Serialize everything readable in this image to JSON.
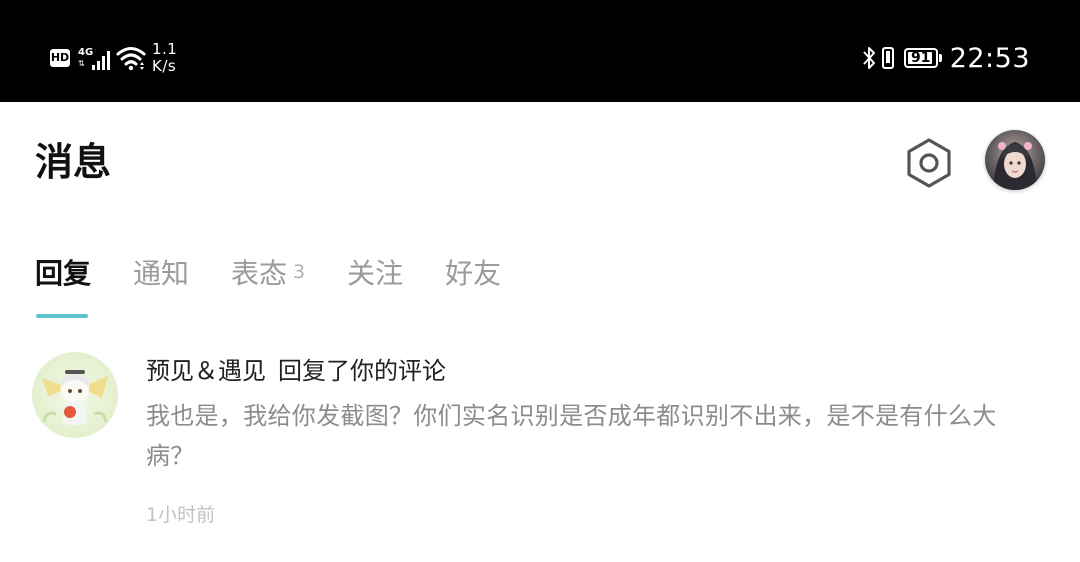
{
  "status_bar": {
    "hd": "HD",
    "network_type": "4G",
    "speed_value": "1.1",
    "speed_unit": "K/s",
    "battery_level": "91",
    "battery_fraction": 0.91,
    "time": "22:53",
    "icons": [
      "signal-icon",
      "wifi-icon",
      "bluetooth-icon",
      "vibrate-icon",
      "battery-icon"
    ]
  },
  "header": {
    "title": "消息",
    "settings_icon": "hexagon-settings-icon",
    "avatar_icon": "user-avatar"
  },
  "tabs": [
    {
      "label": "回复",
      "active": true
    },
    {
      "label": "通知",
      "active": false
    },
    {
      "label": "表态",
      "badge": "3",
      "active": false
    },
    {
      "label": "关注",
      "active": false
    },
    {
      "label": "好友",
      "active": false
    }
  ],
  "colors": {
    "accent": "#5fc2cf",
    "status_bar_bg": "#000000",
    "text_primary": "#111111",
    "text_secondary": "#8c8c8c"
  },
  "reply": {
    "username": "预见＆遇见",
    "action": "回复了你的评论",
    "content": "我也是，我给你发截图？你们实名识别是否成年都识别不出来，是不是有什么大病？",
    "time": "1小时前"
  }
}
